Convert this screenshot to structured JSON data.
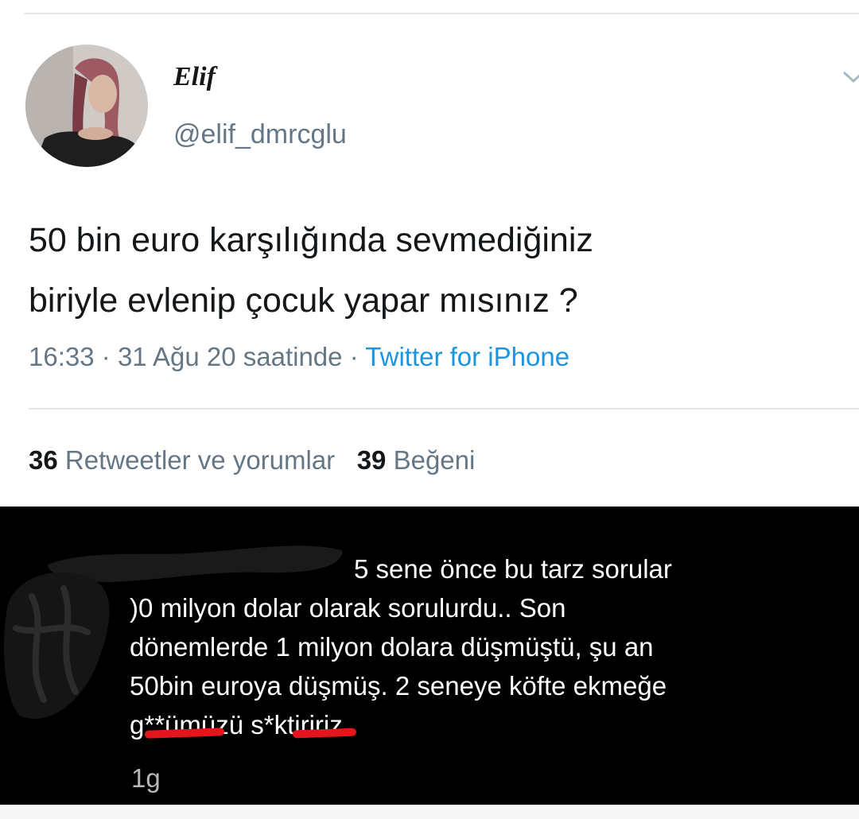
{
  "tweet": {
    "display_name": "Elif",
    "handle": "@elif_dmrcglu",
    "text_lines": [
      "50 bin euro karşılığında sevmediğiniz",
      "biriyle evlenip çocuk yapar mısınız ?"
    ],
    "time": "16:33",
    "date_sep": "·",
    "date": "31 Ağu 20 saatinde",
    "source_sep": "·",
    "source": "Twitter for iPhone",
    "icons": {
      "more": "chevron-down-icon",
      "avatar": "profile-photo"
    }
  },
  "stats": {
    "retweets_count": "36",
    "retweets_label": "Retweetler ve yorumlar",
    "likes_count": "39",
    "likes_label": "Beğeni"
  },
  "reply": {
    "lines": [
      "5 sene önce bu tarz sorular",
      ")0 milyon dolar olarak sorulurdu.. Son",
      "dönemlerde 1 milyon dolara düşmüştü, şu an",
      "50bin euroya düşmüş. 2 seneye köfte ekmeğe",
      "g**ümüzü s*ktiririz"
    ],
    "time": "1g"
  },
  "colors": {
    "text": "#14171a",
    "secondary": "#657786",
    "link": "#1b95e0",
    "reply_background": "#000000",
    "redaction": "#e4151c"
  }
}
